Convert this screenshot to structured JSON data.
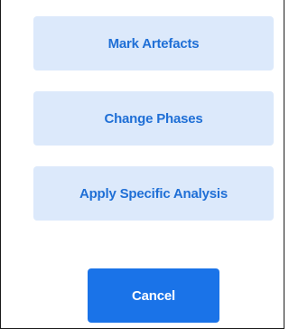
{
  "dialog": {
    "options": [
      {
        "label": "Mark Artefacts"
      },
      {
        "label": "Change Phases"
      },
      {
        "label": "Apply Specific Analysis"
      }
    ],
    "cancel_label": "Cancel"
  },
  "colors": {
    "option_background": "#dce9fb",
    "option_text": "#1f6fd6",
    "primary_button": "#1a73e8",
    "primary_button_text": "#ffffff",
    "border": "#1a1a1a"
  }
}
